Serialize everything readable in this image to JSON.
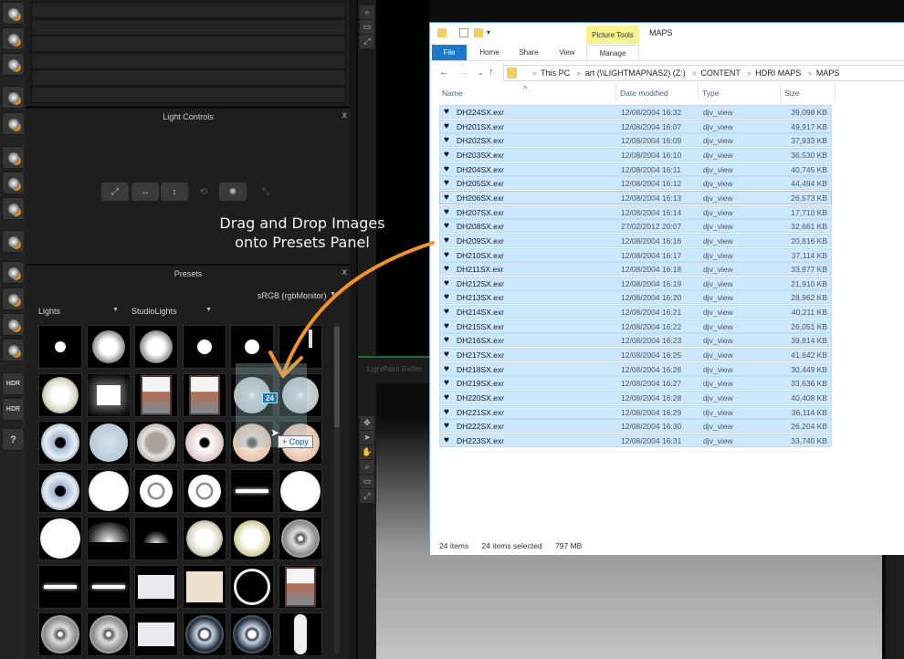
{
  "left_toolbar": {
    "tools": [
      {
        "icon": "spot-light-icon"
      },
      {
        "icon": "area-light-icon"
      },
      {
        "icon": "gobo-light-icon"
      },
      {
        "icon": "ring-light-icon"
      },
      {
        "icon": "light-bulb-icon"
      },
      {
        "icon": "softbox-light-icon"
      },
      {
        "icon": "strip-light-icon"
      },
      {
        "icon": "horizon-light-icon"
      },
      {
        "icon": "atom-icon"
      },
      {
        "icon": "delete-icon"
      },
      {
        "icon": "duplicate-icon"
      },
      {
        "icon": "undo-icon"
      },
      {
        "icon": "redo-icon"
      },
      {
        "icon": "hdr-icon",
        "label": "HDR"
      },
      {
        "icon": "hdr-refresh-icon",
        "label": "HDR"
      },
      {
        "icon": "help-icon",
        "label": "?"
      }
    ]
  },
  "light_controls": {
    "title": "Light Controls",
    "close": "x",
    "buttons": [
      {
        "icon": "scale-icon"
      },
      {
        "icon": "stretch-horizontal-icon"
      },
      {
        "icon": "stretch-vertical-icon"
      },
      {
        "icon": "rotate-icon"
      },
      {
        "icon": "brightness-icon"
      },
      {
        "icon": "resize-diagonal-icon"
      }
    ]
  },
  "presets": {
    "title": "Presets",
    "close": "x",
    "color_space": "sRGB (rgbMonitor)",
    "category": "Lights",
    "subcategory": "StudioLights"
  },
  "annotation": {
    "line1": "Drag and Drop Images",
    "line2": "onto Presets Panel",
    "arrow_color": "#f7931e"
  },
  "drag": {
    "count": "24",
    "tooltip": "+ Copy"
  },
  "viewport": {
    "tabs": "LightPaint  Reflec"
  },
  "explorer": {
    "context_tab": "Picture Tools",
    "title": "MAPS",
    "ribbon_tabs": [
      "File",
      "Home",
      "Share",
      "View",
      "Manage"
    ],
    "breadcrumb": [
      "This PC",
      "art (\\\\LIGHTMAPNAS2) (Z:)",
      "CONTENT",
      "HDRI MAPS",
      "MAPS"
    ],
    "columns": [
      "Name",
      "Date modified",
      "Type",
      "Size"
    ],
    "files": [
      {
        "name": "DH224SX.exr",
        "date": "12/08/2004 16:32",
        "type": "djv_view",
        "size": "39,098 KB"
      },
      {
        "name": "DH201SX.exr",
        "date": "12/08/2004 16:07",
        "type": "djv_view",
        "size": "49,917 KB"
      },
      {
        "name": "DH202SX.exr",
        "date": "12/08/2004 16:09",
        "type": "djv_view",
        "size": "37,933 KB"
      },
      {
        "name": "DH203SX.exr",
        "date": "12/08/2004 16:10",
        "type": "djv_view",
        "size": "36,530 KB"
      },
      {
        "name": "DH204SX.exr",
        "date": "12/08/2004 16:11",
        "type": "djv_view",
        "size": "40,745 KB"
      },
      {
        "name": "DH205SX.exr",
        "date": "12/08/2004 16:12",
        "type": "djv_view",
        "size": "44,494 KB"
      },
      {
        "name": "DH206SX.exr",
        "date": "12/08/2004 16:13",
        "type": "djv_view",
        "size": "26,573 KB"
      },
      {
        "name": "DH207SX.exr",
        "date": "12/08/2004 16:14",
        "type": "djv_view",
        "size": "17,710 KB"
      },
      {
        "name": "DH208SX.exr",
        "date": "27/02/2012 20:07",
        "type": "djv_view",
        "size": "32,661 KB"
      },
      {
        "name": "DH209SX.exr",
        "date": "12/08/2004 16:16",
        "type": "djv_view",
        "size": "20,816 KB"
      },
      {
        "name": "DH210SX.exr",
        "date": "12/08/2004 16:17",
        "type": "djv_view",
        "size": "37,114 KB"
      },
      {
        "name": "DH211SX.exr",
        "date": "12/08/2004 16:18",
        "type": "djv_view",
        "size": "33,877 KB"
      },
      {
        "name": "DH212SX.exr",
        "date": "12/08/2004 16:19",
        "type": "djv_view",
        "size": "21,910 KB"
      },
      {
        "name": "DH213SX.exr",
        "date": "12/08/2004 16:20",
        "type": "djv_view",
        "size": "28,962 KB"
      },
      {
        "name": "DH214SX.exr",
        "date": "12/08/2004 16:21",
        "type": "djv_view",
        "size": "40,211 KB"
      },
      {
        "name": "DH215SX.exr",
        "date": "12/08/2004 16:22",
        "type": "djv_view",
        "size": "26,051 KB"
      },
      {
        "name": "DH216SX.exr",
        "date": "12/08/2004 16:23",
        "type": "djv_view",
        "size": "39,814 KB"
      },
      {
        "name": "DH217SX.exr",
        "date": "12/08/2004 16:25",
        "type": "djv_view",
        "size": "41,642 KB"
      },
      {
        "name": "DH218SX.exr",
        "date": "12/08/2004 16:26",
        "type": "djv_view",
        "size": "30,449 KB"
      },
      {
        "name": "DH219SX.exr",
        "date": "12/08/2004 16:27",
        "type": "djv_view",
        "size": "33,636 KB"
      },
      {
        "name": "DH220SX.exr",
        "date": "12/08/2004 16:28",
        "type": "djv_view",
        "size": "40,408 KB"
      },
      {
        "name": "DH221SX.exr",
        "date": "12/08/2004 16:29",
        "type": "djv_view",
        "size": "36,114 KB"
      },
      {
        "name": "DH222SX.exr",
        "date": "12/08/2004 16:30",
        "type": "djv_view",
        "size": "26,204 KB"
      },
      {
        "name": "DH223SX.exr",
        "date": "12/08/2004 16:31",
        "type": "djv_view",
        "size": "33,740 KB"
      }
    ],
    "status": {
      "item_count": "24 items",
      "selected": "24 items selected",
      "size": "797 MB"
    },
    "colors": {
      "accent": "#1979ca",
      "selection": "#cce8ff",
      "context_tab": "#f7f38a"
    }
  }
}
